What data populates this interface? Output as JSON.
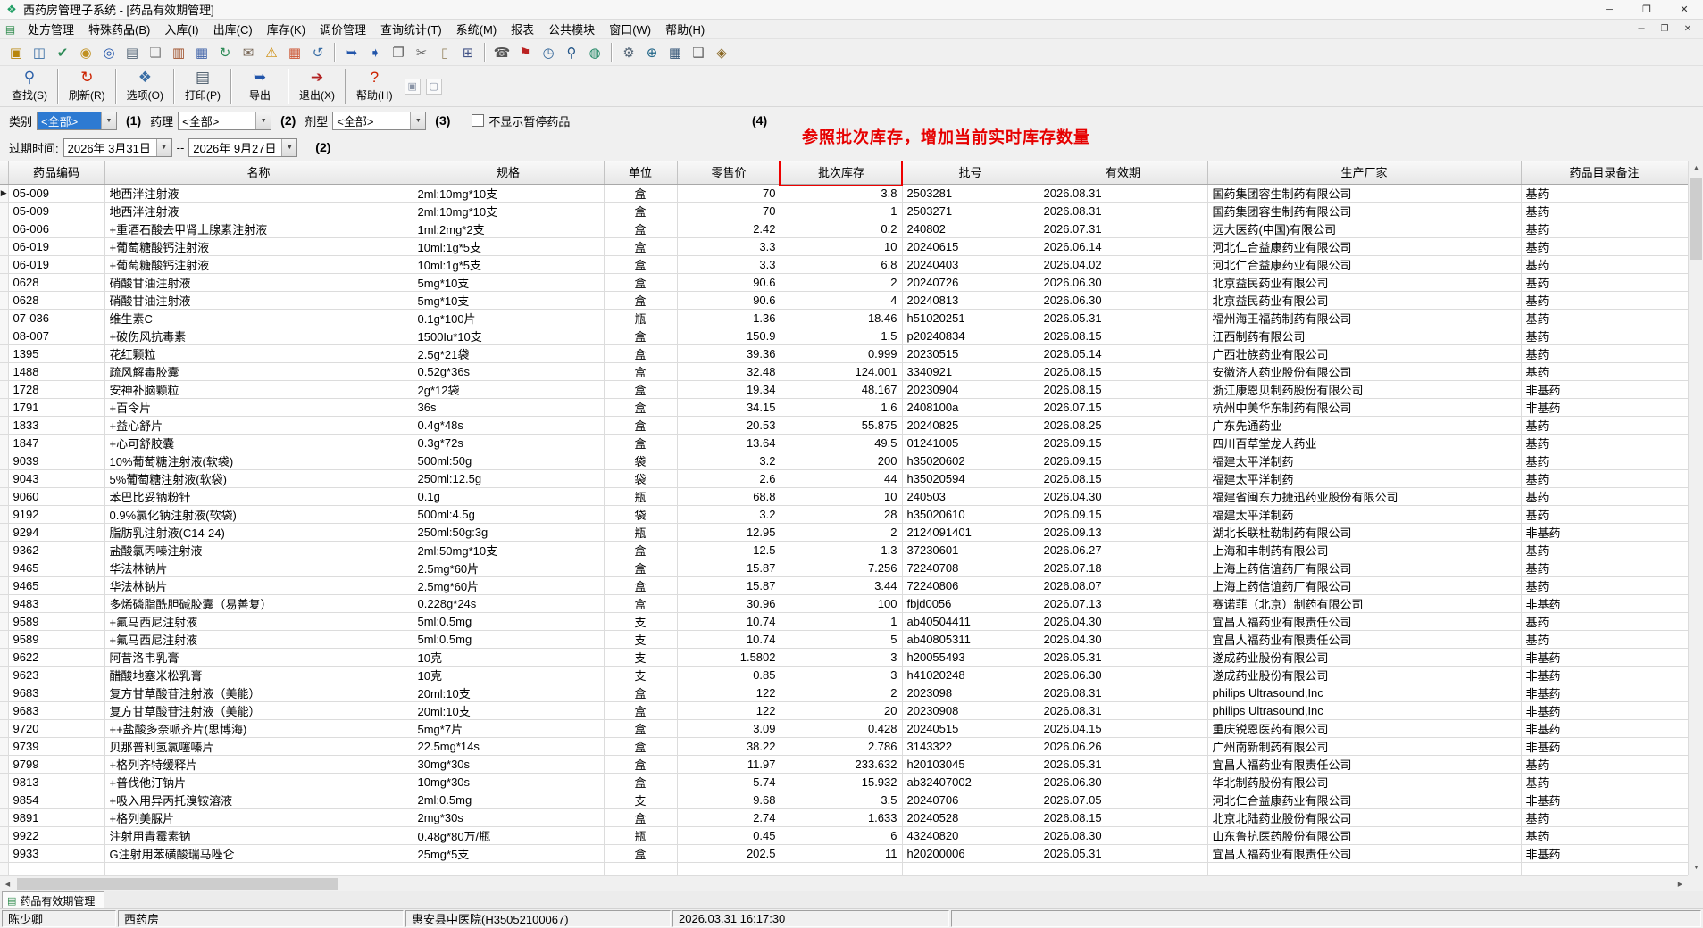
{
  "ui": {
    "dropdown_arrow": "▼",
    "scroll_up": "▲",
    "scroll_down": "▼",
    "scroll_left": "◀",
    "scroll_right": "▶",
    "row_indicator": "▶",
    "app_icon_glyph": "❖",
    "child_icon_glyph": "▤",
    "tab_icon_glyph": "▤"
  },
  "titlebar": {
    "title": "西药房管理子系统 - [药品有效期管理]",
    "minimize": "─",
    "maximize": "❐",
    "close": "✕"
  },
  "menubar": {
    "items": [
      "处方管理",
      "特殊药品(B)",
      "入库(I)",
      "出库(C)",
      "库存(K)",
      "调价管理",
      "查询统计(T)",
      "系统(M)",
      "报表",
      "公共模块",
      "窗口(W)",
      "帮助(H)"
    ],
    "child_minimize": "─",
    "child_restore": "❐",
    "child_close": "✕"
  },
  "toolbar_small": {
    "groups": [
      [
        {
          "name": "open-icon",
          "glyph": "▣",
          "color": "#b8860b"
        },
        {
          "name": "save-icon",
          "glyph": "◫",
          "color": "#3a6ea5"
        },
        {
          "name": "approve-icon",
          "glyph": "✔",
          "color": "#2e8b57"
        },
        {
          "name": "money-icon",
          "glyph": "◉",
          "color": "#c09020"
        },
        {
          "name": "binoculars-icon",
          "glyph": "◎",
          "color": "#2255aa"
        },
        {
          "name": "print-icon",
          "glyph": "▤",
          "color": "#556677"
        },
        {
          "name": "document-icon",
          "glyph": "❏",
          "color": "#888888"
        },
        {
          "name": "package-icon",
          "glyph": "▥",
          "color": "#a0522d"
        },
        {
          "name": "chart-icon",
          "glyph": "▦",
          "color": "#4466aa"
        },
        {
          "name": "refresh-icon",
          "glyph": "↻",
          "color": "#2e8b57"
        },
        {
          "name": "mail-icon",
          "glyph": "✉",
          "color": "#776655"
        },
        {
          "name": "alert-icon",
          "glyph": "⚠",
          "color": "#cc8800"
        },
        {
          "name": "calendar-icon",
          "glyph": "▦",
          "color": "#cc5533"
        },
        {
          "name": "undo-icon",
          "glyph": "↺",
          "color": "#3a6ea5"
        }
      ],
      [
        {
          "name": "export-icon",
          "glyph": "➥",
          "color": "#2255aa"
        },
        {
          "name": "import-icon",
          "glyph": "➧",
          "color": "#2255aa"
        },
        {
          "name": "copy-icon",
          "glyph": "❐",
          "color": "#666666"
        },
        {
          "name": "cut-icon",
          "glyph": "✂",
          "color": "#666666"
        },
        {
          "name": "paste-icon",
          "glyph": "▯",
          "color": "#998866"
        },
        {
          "name": "calculator-icon",
          "glyph": "⊞",
          "color": "#445588"
        }
      ],
      [
        {
          "name": "phone-icon",
          "glyph": "☎",
          "color": "#555555"
        },
        {
          "name": "flag-icon",
          "glyph": "⚑",
          "color": "#bb2222"
        },
        {
          "name": "clock-icon",
          "glyph": "◷",
          "color": "#336699"
        },
        {
          "name": "search-icon",
          "glyph": "⚲",
          "color": "#225588"
        },
        {
          "name": "globe-icon",
          "glyph": "◍",
          "color": "#228866"
        }
      ],
      [
        {
          "name": "settings-icon",
          "glyph": "⚙",
          "color": "#556677"
        },
        {
          "name": "zoom-icon",
          "glyph": "⊕",
          "color": "#226688"
        },
        {
          "name": "grid-icon",
          "glyph": "▦",
          "color": "#335577"
        },
        {
          "name": "layers-icon",
          "glyph": "❑",
          "color": "#666666"
        },
        {
          "name": "lock-icon",
          "glyph": "◈",
          "color": "#886622"
        }
      ]
    ]
  },
  "toolbar_main": {
    "buttons": [
      {
        "name": "find-button",
        "label": "查找(S)",
        "glyph": "⚲",
        "color": "#2a5fa8"
      },
      {
        "name": "refresh-button",
        "label": "刷新(R)",
        "glyph": "↻",
        "color": "#cc2200"
      },
      {
        "name": "options-button",
        "label": "选项(O)",
        "glyph": "❖",
        "color": "#3a6ea5"
      },
      {
        "name": "print-button",
        "label": "打印(P)",
        "glyph": "▤",
        "color": "#445566"
      },
      {
        "name": "export-button",
        "label": "导出",
        "glyph": "➥",
        "color": "#2255aa"
      },
      {
        "name": "exit-button",
        "label": "退出(X)",
        "glyph": "➔",
        "color": "#b22222"
      },
      {
        "name": "help-button",
        "label": "帮助(H)",
        "glyph": "?",
        "color": "#cc2200"
      }
    ],
    "extra_icons": [
      {
        "name": "pin-icon",
        "glyph": "▣"
      },
      {
        "name": "collapse-icon",
        "glyph": "▢"
      }
    ]
  },
  "filters": {
    "category_label": "类别",
    "category_value": "<全部>",
    "pharmacology_label": "药理",
    "pharmacology_value": "<全部>",
    "dosage_label": "剂型",
    "dosage_value": "<全部>",
    "hide_paused_label": "不显示暂停药品",
    "markers": {
      "m1": "(1)",
      "m2": "(2)",
      "m3": "(3)",
      "m4": "(4)",
      "m_date": "(2)"
    },
    "expiry_label": "过期时间:",
    "date_from": "2026年 3月31日",
    "date_to": "2026年 9月27日",
    "date_separator": "--"
  },
  "annotation": {
    "text": "参照批次库存，增加当前实时库存数量",
    "color": "#e60000"
  },
  "table": {
    "columns": [
      "药品编码",
      "名称",
      "规格",
      "单位",
      "零售价",
      "批次库存",
      "批号",
      "有效期",
      "生产厂家",
      "药品目录备注"
    ],
    "rows": [
      [
        "05-009",
        "地西泮注射液",
        "2ml:10mg*10支",
        "盒",
        "70",
        "3.8",
        "2503281",
        "2026.08.31",
        "国药集团容生制药有限公司",
        "基药"
      ],
      [
        "05-009",
        "地西泮注射液",
        "2ml:10mg*10支",
        "盒",
        "70",
        "1",
        "2503271",
        "2026.08.31",
        "国药集团容生制药有限公司",
        "基药"
      ],
      [
        "06-006",
        "+重酒石酸去甲肾上腺素注射液",
        "1ml:2mg*2支",
        "盒",
        "2.42",
        "0.2",
        "240802",
        "2026.07.31",
        "远大医药(中国)有限公司",
        "基药"
      ],
      [
        "06-019",
        "+葡萄糖酸钙注射液",
        "10ml:1g*5支",
        "盒",
        "3.3",
        "10",
        "20240615",
        "2026.06.14",
        "河北仁合益康药业有限公司",
        "基药"
      ],
      [
        "06-019",
        "+葡萄糖酸钙注射液",
        "10ml:1g*5支",
        "盒",
        "3.3",
        "6.8",
        "20240403",
        "2026.04.02",
        "河北仁合益康药业有限公司",
        "基药"
      ],
      [
        "0628",
        "硝酸甘油注射液",
        "5mg*10支",
        "盒",
        "90.6",
        "2",
        "20240726",
        "2026.06.30",
        "北京益民药业有限公司",
        "基药"
      ],
      [
        "0628",
        "硝酸甘油注射液",
        "5mg*10支",
        "盒",
        "90.6",
        "4",
        "20240813",
        "2026.06.30",
        "北京益民药业有限公司",
        "基药"
      ],
      [
        "07-036",
        "维生素C",
        "0.1g*100片",
        "瓶",
        "1.36",
        "18.46",
        "h51020251",
        "2026.05.31",
        "福州海王福药制药有限公司",
        "基药"
      ],
      [
        "08-007",
        "+破伤风抗毒素",
        "1500Iu*10支",
        "盒",
        "150.9",
        "1.5",
        "p20240834",
        "2026.08.15",
        "江西制药有限公司",
        "基药"
      ],
      [
        "1395",
        "花红颗粒",
        "2.5g*21袋",
        "盒",
        "39.36",
        "0.999",
        "20230515",
        "2026.05.14",
        "广西壮族药业有限公司",
        "基药"
      ],
      [
        "1488",
        "疏风解毒胶囊",
        "0.52g*36s",
        "盒",
        "32.48",
        "124.001",
        "3340921",
        "2026.08.15",
        "安徽济人药业股份有限公司",
        "基药"
      ],
      [
        "1728",
        "安神补脑颗粒",
        "2g*12袋",
        "盒",
        "19.34",
        "48.167",
        "20230904",
        "2026.08.15",
        "浙江康恩贝制药股份有限公司",
        "非基药"
      ],
      [
        "1791",
        "+百令片",
        "36s",
        "盒",
        "34.15",
        "1.6",
        "2408100a",
        "2026.07.15",
        "杭州中美华东制药有限公司",
        "非基药"
      ],
      [
        "1833",
        "+益心舒片",
        "0.4g*48s",
        "盒",
        "20.53",
        "55.875",
        "20240825",
        "2026.08.25",
        "广东先通药业",
        "基药"
      ],
      [
        "1847",
        "+心可舒胶囊",
        "0.3g*72s",
        "盒",
        "13.64",
        "49.5",
        "01241005",
        "2026.09.15",
        "四川百草堂龙人药业",
        "基药"
      ],
      [
        "9039",
        "10%葡萄糖注射液(软袋)",
        "500ml:50g",
        "袋",
        "3.2",
        "200",
        "h35020602",
        "2026.09.15",
        "福建太平洋制药",
        "基药"
      ],
      [
        "9043",
        "5%葡萄糖注射液(软袋)",
        "250ml:12.5g",
        "袋",
        "2.6",
        "44",
        "h35020594",
        "2026.08.15",
        "福建太平洋制药",
        "基药"
      ],
      [
        "9060",
        "苯巴比妥钠粉针",
        "0.1g",
        "瓶",
        "68.8",
        "10",
        "240503",
        "2026.04.30",
        "福建省闽东力捷迅药业股份有限公司",
        "基药"
      ],
      [
        "9192",
        "0.9%氯化钠注射液(软袋)",
        "500ml:4.5g",
        "袋",
        "3.2",
        "28",
        "h35020610",
        "2026.09.15",
        "福建太平洋制药",
        "基药"
      ],
      [
        "9294",
        "脂肪乳注射液(C14-24)",
        "250ml:50g:3g",
        "瓶",
        "12.95",
        "2",
        "2124091401",
        "2026.09.13",
        "湖北长联杜勒制药有限公司",
        "非基药"
      ],
      [
        "9362",
        "盐酸氯丙嗪注射液",
        "2ml:50mg*10支",
        "盒",
        "12.5",
        "1.3",
        "37230601",
        "2026.06.27",
        "上海和丰制药有限公司",
        "基药"
      ],
      [
        "9465",
        "华法林钠片",
        "2.5mg*60片",
        "盒",
        "15.87",
        "7.256",
        "72240708",
        "2026.07.18",
        "上海上药信谊药厂有限公司",
        "基药"
      ],
      [
        "9465",
        "华法林钠片",
        "2.5mg*60片",
        "盒",
        "15.87",
        "3.44",
        "72240806",
        "2026.08.07",
        "上海上药信谊药厂有限公司",
        "基药"
      ],
      [
        "9483",
        "多烯磷脂酰胆碱胶囊（易善复）",
        "0.228g*24s",
        "盒",
        "30.96",
        "100",
        "fbjd0056",
        "2026.07.13",
        "赛诺菲（北京）制药有限公司",
        "非基药"
      ],
      [
        "9589",
        "+氟马西尼注射液",
        "5ml:0.5mg",
        "支",
        "10.74",
        "1",
        "ab40504411",
        "2026.04.30",
        "宜昌人福药业有限责任公司",
        "基药"
      ],
      [
        "9589",
        "+氟马西尼注射液",
        "5ml:0.5mg",
        "支",
        "10.74",
        "5",
        "ab40805311",
        "2026.04.30",
        "宜昌人福药业有限责任公司",
        "基药"
      ],
      [
        "9622",
        "阿昔洛韦乳膏",
        "10克",
        "支",
        "1.5802",
        "3",
        "h20055493",
        "2026.05.31",
        "遂成药业股份有限公司",
        "非基药"
      ],
      [
        "9623",
        "醋酸地塞米松乳膏",
        "10克",
        "支",
        "0.85",
        "3",
        "h41020248",
        "2026.06.30",
        "遂成药业股份有限公司",
        "非基药"
      ],
      [
        "9683",
        "复方甘草酸苷注射液（美能）",
        "20ml:10支",
        "盒",
        "122",
        "2",
        "2023098",
        "2026.08.31",
        "philips Ultrasound,Inc",
        "非基药"
      ],
      [
        "9683",
        "复方甘草酸苷注射液（美能）",
        "20ml:10支",
        "盒",
        "122",
        "20",
        "20230908",
        "2026.08.31",
        "philips Ultrasound,Inc",
        "非基药"
      ],
      [
        "9720",
        "++盐酸多奈哌齐片(思博海)",
        "5mg*7片",
        "盒",
        "3.09",
        "0.428",
        "20240515",
        "2026.04.15",
        "重庆锐恩医药有限公司",
        "非基药"
      ],
      [
        "9739",
        "贝那普利氢氯噻嗪片",
        "22.5mg*14s",
        "盒",
        "38.22",
        "2.786",
        "3143322",
        "2026.06.26",
        "广州南新制药有限公司",
        "非基药"
      ],
      [
        "9799",
        "+格列齐特缓释片",
        "30mg*30s",
        "盒",
        "11.97",
        "233.632",
        "h20103045",
        "2026.05.31",
        "宜昌人福药业有限责任公司",
        "基药"
      ],
      [
        "9813",
        "+普伐他汀钠片",
        "10mg*30s",
        "盒",
        "5.74",
        "15.932",
        "ab32407002",
        "2026.06.30",
        "华北制药股份有限公司",
        "基药"
      ],
      [
        "9854",
        "+吸入用异丙托溴铵溶液",
        "2ml:0.5mg",
        "支",
        "9.68",
        "3.5",
        "20240706",
        "2026.07.05",
        "河北仁合益康药业有限公司",
        "非基药"
      ],
      [
        "9891",
        "+格列美脲片",
        "2mg*30s",
        "盒",
        "2.74",
        "1.633",
        "20240528",
        "2026.08.15",
        "北京北陆药业股份有限公司",
        "基药"
      ],
      [
        "9922",
        "注射用青霉素钠",
        "0.48g*80万/瓶",
        "瓶",
        "0.45",
        "6",
        "43240820",
        "2026.08.30",
        "山东鲁抗医药股份有限公司",
        "基药"
      ],
      [
        "9933",
        "G注射用苯磺酸瑞马唑仑",
        "25mg*5支",
        "盒",
        "202.5",
        "11",
        "h20200006",
        "2026.05.31",
        "宜昌人福药业有限责任公司",
        "非基药"
      ]
    ]
  },
  "tabbar": {
    "tab": "药品有效期管理"
  },
  "statusbar": {
    "user": "陈少卿",
    "department": "西药房",
    "hospital": "惠安县中医院(H35052100067)",
    "datetime": "2026.03.31 16:17:30"
  }
}
